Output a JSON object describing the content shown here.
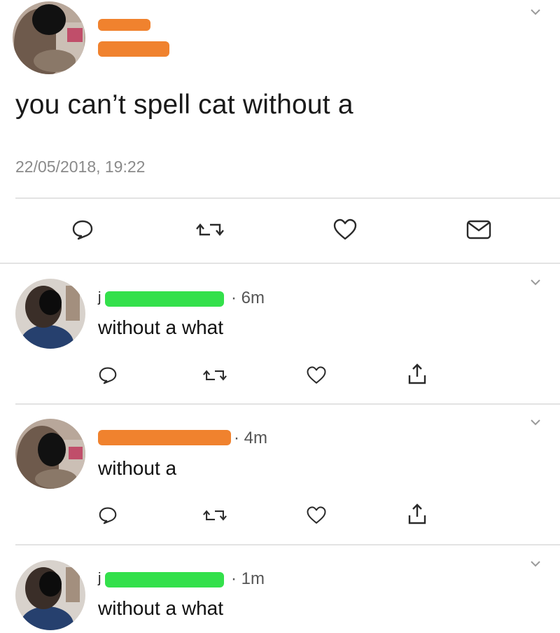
{
  "tweet": {
    "text": "you can’t spell cat without a",
    "timestamp": "22/05/2018, 19:22"
  },
  "replies": [
    {
      "time_label": "· 6m",
      "text": "without a what"
    },
    {
      "time_label": "· 4m",
      "text": "without a"
    },
    {
      "time_label": "· 1m",
      "text": "without a what"
    }
  ],
  "icons": {
    "main_actions": [
      "reply-icon",
      "retweet-icon",
      "like-icon",
      "dm-icon"
    ],
    "reply_actions": [
      "reply-icon",
      "retweet-icon",
      "like-icon",
      "share-icon"
    ]
  },
  "colors": {
    "redaction_orange": "#f0822e",
    "redaction_green": "#33e04b",
    "text_gray": "#8a8a8a",
    "divider": "#e3e3e3"
  }
}
